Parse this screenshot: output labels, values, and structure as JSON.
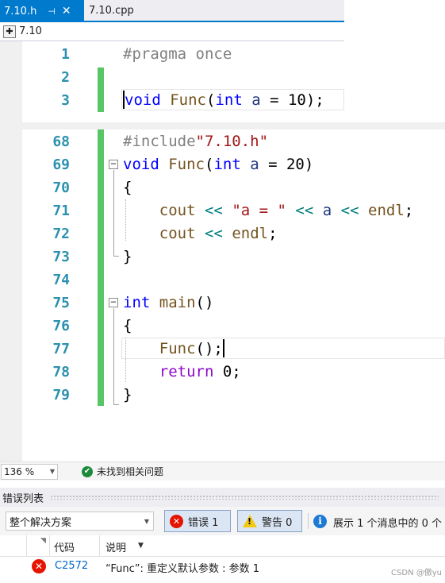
{
  "tabs": [
    {
      "label": "7.10.h",
      "active": true,
      "pin_icon": "pin-icon",
      "close_icon": "close-icon"
    },
    {
      "label": "7.10.cpp",
      "active": false
    }
  ],
  "navbar": {
    "project": "7.10",
    "icon": "project-icon"
  },
  "header_file": {
    "lines": [
      {
        "num": "1",
        "segments": [
          {
            "t": "#pragma once",
            "c": "pp"
          }
        ]
      },
      {
        "num": "2",
        "segments": []
      },
      {
        "num": "3",
        "segments": [
          {
            "t": "void",
            "c": "kw"
          },
          {
            "t": " ",
            "c": "pl"
          },
          {
            "t": "Func",
            "c": "fn"
          },
          {
            "t": "(",
            "c": "pl"
          },
          {
            "t": "int",
            "c": "kw"
          },
          {
            "t": " ",
            "c": "pl"
          },
          {
            "t": "a",
            "c": "id"
          },
          {
            "t": " = 10);",
            "c": "pl"
          }
        ]
      }
    ]
  },
  "source_file": {
    "lines": [
      {
        "num": "68",
        "segments": [
          {
            "t": "#include",
            "c": "pp"
          },
          {
            "t": "\"7.10.h\"",
            "c": "str"
          }
        ]
      },
      {
        "num": "69",
        "segments": [
          {
            "t": "void",
            "c": "kw"
          },
          {
            "t": " ",
            "c": "pl"
          },
          {
            "t": "Func",
            "c": "fn"
          },
          {
            "t": "(",
            "c": "pl"
          },
          {
            "t": "int",
            "c": "kw"
          },
          {
            "t": " ",
            "c": "pl"
          },
          {
            "t": "a",
            "c": "id"
          },
          {
            "t": " = 20)",
            "c": "pl"
          }
        ]
      },
      {
        "num": "70",
        "segments": [
          {
            "t": "{",
            "c": "pl"
          }
        ]
      },
      {
        "num": "71",
        "segments": [
          {
            "t": "    cout",
            "c": "fn"
          },
          {
            "t": " ",
            "c": "pl"
          },
          {
            "t": "<<",
            "c": "op"
          },
          {
            "t": " ",
            "c": "pl"
          },
          {
            "t": "\"a = \"",
            "c": "str"
          },
          {
            "t": " ",
            "c": "pl"
          },
          {
            "t": "<<",
            "c": "op"
          },
          {
            "t": " ",
            "c": "pl"
          },
          {
            "t": "a",
            "c": "id"
          },
          {
            "t": " ",
            "c": "pl"
          },
          {
            "t": "<<",
            "c": "op"
          },
          {
            "t": " ",
            "c": "pl"
          },
          {
            "t": "endl",
            "c": "fn"
          },
          {
            "t": ";",
            "c": "pl"
          }
        ]
      },
      {
        "num": "72",
        "segments": [
          {
            "t": "    cout",
            "c": "fn"
          },
          {
            "t": " ",
            "c": "pl"
          },
          {
            "t": "<<",
            "c": "op"
          },
          {
            "t": " ",
            "c": "pl"
          },
          {
            "t": "endl",
            "c": "fn"
          },
          {
            "t": ";",
            "c": "pl"
          }
        ]
      },
      {
        "num": "73",
        "segments": [
          {
            "t": "}",
            "c": "pl"
          }
        ]
      },
      {
        "num": "74",
        "segments": []
      },
      {
        "num": "75",
        "segments": [
          {
            "t": "int",
            "c": "kw"
          },
          {
            "t": " ",
            "c": "pl"
          },
          {
            "t": "main",
            "c": "fn"
          },
          {
            "t": "()",
            "c": "pl"
          }
        ]
      },
      {
        "num": "76",
        "segments": [
          {
            "t": "{",
            "c": "pl"
          }
        ]
      },
      {
        "num": "77",
        "segments": [
          {
            "t": "    Func",
            "c": "fn"
          },
          {
            "t": "();",
            "c": "pl"
          }
        ]
      },
      {
        "num": "78",
        "segments": [
          {
            "t": "    ",
            "c": "pl"
          },
          {
            "t": "return",
            "c": "kw2"
          },
          {
            "t": " 0;",
            "c": "pl"
          }
        ]
      },
      {
        "num": "79",
        "segments": [
          {
            "t": "}",
            "c": "pl"
          }
        ]
      }
    ]
  },
  "statusbar": {
    "zoom": "136 %",
    "status_text": "未找到相关问题",
    "status_icon": "check-circle-icon"
  },
  "error_list": {
    "title": "错误列表",
    "scope": "整个解决方案",
    "errors_button": "错误 1",
    "warnings_button": "警告 0",
    "info_text": "展示 1 个消息中的 0 个",
    "columns": {
      "code": "代码",
      "description": "说明"
    },
    "rows": [
      {
        "code": "C2572",
        "description": "“Func”: 重定义默认参数 : 参数 1",
        "icon": "error-icon"
      }
    ]
  },
  "watermark": "CSDN @傲yu",
  "colors": {
    "accent": "#007acc",
    "line_number": "#2b91af",
    "change_bar": "#57c665",
    "error": "#e51400"
  }
}
